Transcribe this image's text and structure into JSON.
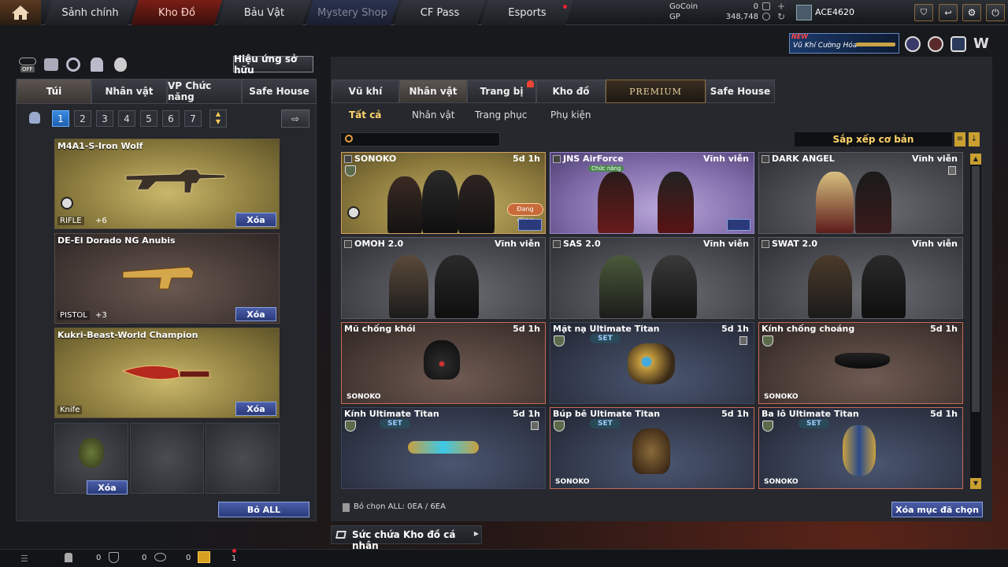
{
  "topnav": {
    "items": [
      {
        "label": "Sảnh chính"
      },
      {
        "label": "Kho Đồ"
      },
      {
        "label": "Bảu Vật"
      },
      {
        "label": "Mystery Shop"
      },
      {
        "label": "CF Pass"
      },
      {
        "label": "Esports"
      }
    ]
  },
  "currency": {
    "gocoin_label": "GoCoin",
    "gocoin_value": "0",
    "gp_label": "GP",
    "gp_value": "348,748"
  },
  "user": {
    "name": "ACE4620"
  },
  "banner": {
    "new_label": "NEW",
    "text": "Vũ Khí Cường Hóa"
  },
  "left": {
    "own_effect_button": "Hiệu ứng sở hữu",
    "off_label": "OFF",
    "tabs": [
      "Túi",
      "Nhân vật",
      "VP Chức năng",
      "Safe House"
    ],
    "pages": [
      "1",
      "2",
      "3",
      "4",
      "5",
      "6",
      "7"
    ],
    "weapons": [
      {
        "name": "M4A1-S-Iron Wolf",
        "type": "RIFLE",
        "upgrade": "+6",
        "delete": "Xóa"
      },
      {
        "name": "DE-El Dorado NG Anubis",
        "type": "PISTOL",
        "upgrade": "+3",
        "delete": "Xóa"
      },
      {
        "name": "Kukri-Beast-World Champion",
        "type": "Knife",
        "delete": "Xóa"
      }
    ],
    "grenade_delete": "Xóa",
    "remove_all": "Bỏ ALL"
  },
  "right": {
    "tabs": [
      "Vũ khí",
      "Nhân vật",
      "Trang bị",
      "Kho đồ",
      "PREMIUM",
      "Safe House"
    ],
    "subtabs": [
      "Tất cả",
      "Nhân vật",
      "Trang phục",
      "Phụ kiện"
    ],
    "sort_label": "Sắp xếp cơ bản",
    "items": [
      {
        "name": "SONOKO",
        "duration": "5d 1h",
        "badge": "Đang dùng"
      },
      {
        "name": "JNS AirForce",
        "duration": "Vĩnh viễn",
        "tag": "Chức năng"
      },
      {
        "name": "DARK ANGEL",
        "duration": "Vĩnh viễn"
      },
      {
        "name": "OMOH 2.0",
        "duration": "Vĩnh viễn"
      },
      {
        "name": "SAS 2.0",
        "duration": "Vĩnh viễn"
      },
      {
        "name": "SWAT 2.0",
        "duration": "Vĩnh viễn"
      },
      {
        "name": "Mũ chống khói",
        "duration": "5d 1h",
        "owner": "SONOKO"
      },
      {
        "name": "Mặt nạ Ultimate Titan",
        "duration": "5d 1h",
        "set": "SET"
      },
      {
        "name": "Kính chống choáng",
        "duration": "5d 1h",
        "owner": "SONOKO"
      },
      {
        "name": "Kính Ultimate Titan",
        "duration": "5d 1h",
        "set": "SET"
      },
      {
        "name": "Búp bê Ultimate Titan",
        "duration": "5d 1h",
        "set": "SET",
        "owner": "SONOKO"
      },
      {
        "name": "Ba lô Ultimate Titan",
        "duration": "5d 1h",
        "set": "SET",
        "owner": "SONOKO"
      }
    ],
    "deselect_all": "Bỏ chọn ALL: 0EA / 6EA",
    "delete_selected": "Xóa mục đã chọn",
    "capacity": "Sức chứa Kho đồ cá nhân"
  },
  "bottom": {
    "count1": "0",
    "count2": "0",
    "count3": "0",
    "gift_count": "1"
  },
  "colors": {
    "accent_gold": "#ffd36a",
    "button_blue": "#2a3a7a",
    "active_tab_red": "#7a1e16"
  }
}
